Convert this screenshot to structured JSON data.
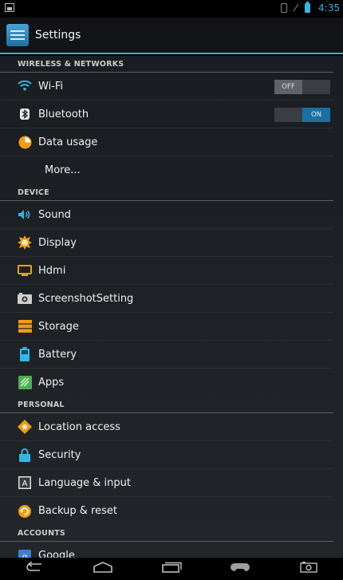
{
  "status": {
    "time": "4:35"
  },
  "header": {
    "title": "Settings"
  },
  "sections": [
    {
      "header": "WIRELESS & NETWORKS",
      "items": [
        {
          "label": "Wi-Fi",
          "toggle": "OFF"
        },
        {
          "label": "Bluetooth",
          "toggle": "ON"
        },
        {
          "label": "Data usage"
        },
        {
          "label": "More..."
        }
      ]
    },
    {
      "header": "DEVICE",
      "items": [
        {
          "label": "Sound"
        },
        {
          "label": "Display"
        },
        {
          "label": "Hdmi"
        },
        {
          "label": "ScreenshotSetting"
        },
        {
          "label": "Storage"
        },
        {
          "label": "Battery"
        },
        {
          "label": "Apps"
        }
      ]
    },
    {
      "header": "PERSONAL",
      "items": [
        {
          "label": "Location access"
        },
        {
          "label": "Security"
        },
        {
          "label": "Language & input"
        },
        {
          "label": "Backup & reset"
        }
      ]
    },
    {
      "header": "ACCOUNTS",
      "items": [
        {
          "label": "Google"
        }
      ]
    }
  ],
  "icons": {
    "accent": "#33b5e5",
    "wifi": "wifi-icon",
    "bluetooth": "bluetooth-icon",
    "data_usage": "data-usage-icon",
    "sound": "speaker-icon",
    "display": "brightness-icon",
    "hdmi": "monitor-icon",
    "screenshot": "camera-icon",
    "storage": "storage-icon",
    "battery": "battery-icon",
    "apps": "apps-icon",
    "location": "location-icon",
    "security": "lock-icon",
    "language": "keyboard-icon",
    "backup": "backup-icon",
    "google": "google-icon"
  }
}
